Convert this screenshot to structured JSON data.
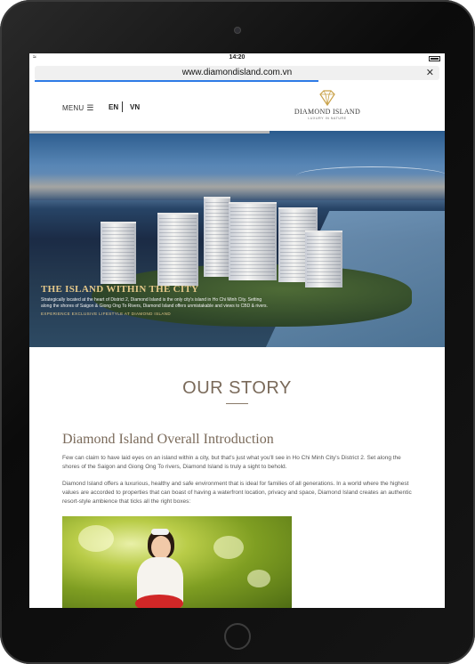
{
  "status": {
    "time": "14:20"
  },
  "browser": {
    "url": "www.diamondisland.com.vn",
    "load_progress": 0.7
  },
  "nav": {
    "menu_label": "MENU",
    "lang_en": "EN",
    "lang_vn": "VN",
    "logo_brand": "DIAMOND ISLAND",
    "logo_tagline": "LUXURY IN NATURE"
  },
  "hero": {
    "title": "THE ISLAND WITHIN THE CITY",
    "body": "Strategically located at the heart of District 2, Diamond Island is the only city's island in Ho Chi Minh City. Setting along the shores of Saigon & Giong Ong To Rivers, Diamond Island offers unmistakable and views to CBD & rivers.",
    "subtitle": "EXPERIENCE EXCLUSIVE LIFESTYLE AT DIAMOND ISLAND"
  },
  "story": {
    "heading": "OUR STORY",
    "intro_title": "Diamond Island Overall Introduction",
    "paragraphs": [
      "Few can claim to have laid eyes on an island within a city, but that's just what you'll see in Ho Chi Minh City's District 2. Set along the shores of the Saigon and Giong Ong To rivers, Diamond Island is truly a sight to behold.",
      "Diamond Island offers a luxurious, healthy and safe environment that is ideal for families of all generations. In a world where the highest values are accorded to properties that can boast of having a waterfront location, privacy and space, Diamond Island creates an authentic resort-style ambience that ticks all the right boxes:"
    ]
  },
  "colors": {
    "accent_text": "#7a6a5a",
    "hero_gold": "#e6c98a",
    "progress_blue": "#2e7be6"
  }
}
